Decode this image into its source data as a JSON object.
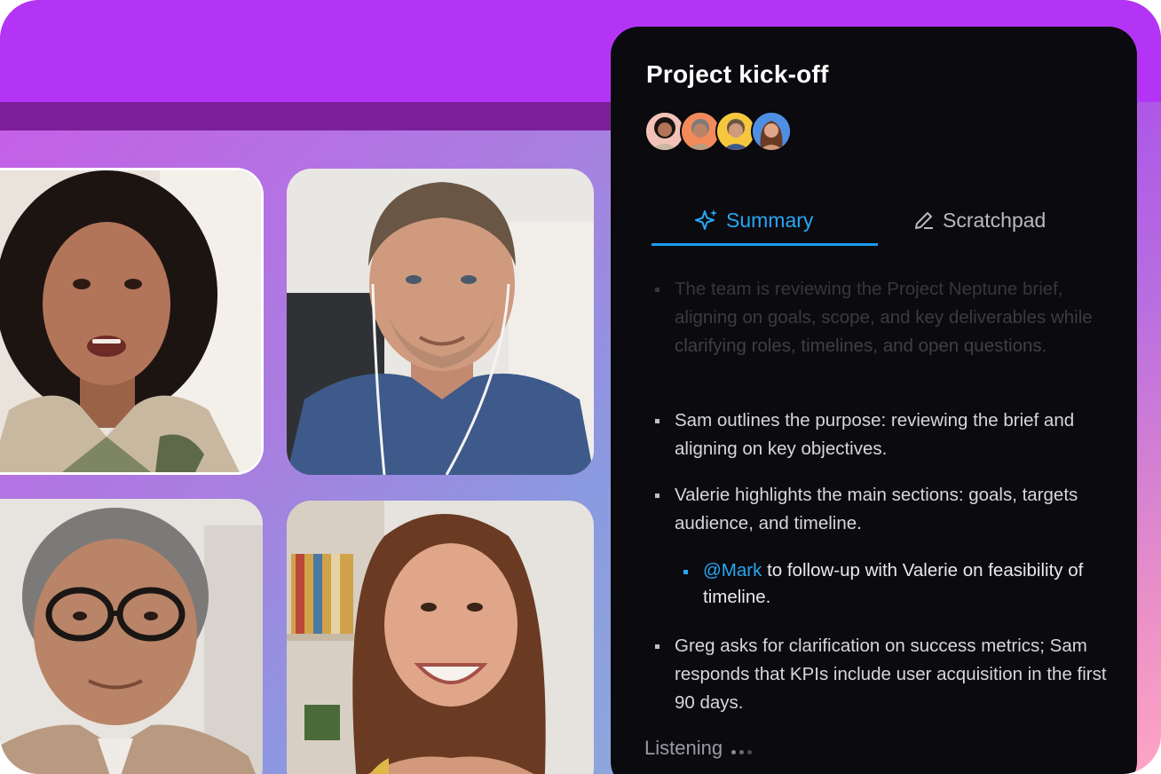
{
  "meeting": {
    "title": "Project kick-off",
    "participants": [
      {
        "name": "participant-1",
        "color": "#f2c2b8"
      },
      {
        "name": "participant-2",
        "color": "#f28a5c"
      },
      {
        "name": "participant-3",
        "color": "#f4c73d"
      },
      {
        "name": "participant-4",
        "color": "#4f8fe3"
      }
    ]
  },
  "tabs": [
    {
      "label": "Summary",
      "icon": "sparkle-icon",
      "active": true
    },
    {
      "label": "Scratchpad",
      "icon": "pencil-icon",
      "active": false
    }
  ],
  "summary": {
    "items": [
      {
        "text": "The team is reviewing the Project Neptune brief, aligning on goals, scope, and key deliverables while clarifying roles, timelines, and open questions.",
        "faded": true
      },
      {
        "text": "Sam outlines the purpose: reviewing the brief and aligning on key objectives."
      },
      {
        "text": "Valerie highlights the main sections: goals, targets audience, and timeline."
      },
      {
        "mention": "@Mark",
        "text": " to follow-up with Valerie on feasibility of timeline.",
        "sub": true
      },
      {
        "text": "Greg asks for clarification on success metrics; Sam responds that KPIs include user acquisition in the first 90 days."
      }
    ]
  },
  "status": {
    "listening_label": "Listening"
  },
  "colors": {
    "accent": "#27a7f5",
    "panel_bg": "#0b0a0e",
    "brand_purple": "#b334f5"
  }
}
